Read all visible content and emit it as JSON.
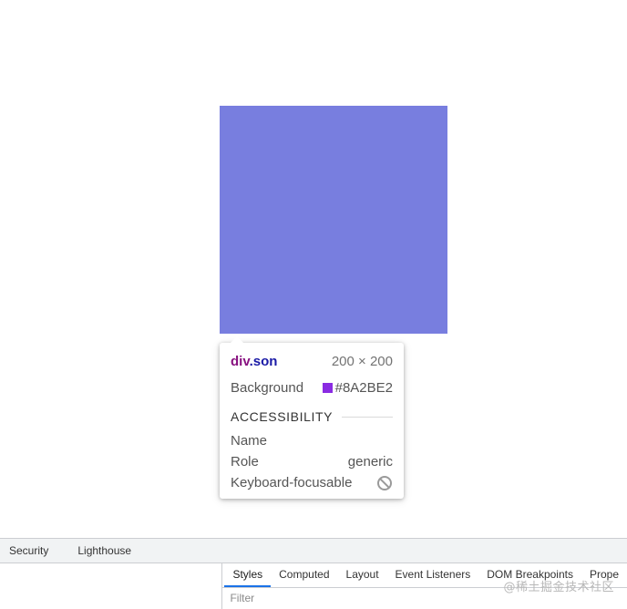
{
  "inspected_element": {
    "color": "#787EDF"
  },
  "tooltip": {
    "tag": "div",
    "class_name": ".son",
    "size": "200 × 200",
    "background_label": "Background",
    "background_value": "#8A2BE2",
    "background_color": "#8A2BE2",
    "accessibility_title": "ACCESSIBILITY",
    "name_label": "Name",
    "name_value": "",
    "role_label": "Role",
    "role_value": "generic",
    "keyboard_label": "Keyboard-focusable",
    "keyboard_icon": "not-allowed-icon"
  },
  "devtools": {
    "main_tabs": [
      {
        "label": "Security"
      },
      {
        "label": "Lighthouse"
      }
    ],
    "side_tabs": [
      {
        "label": "Styles",
        "active": true
      },
      {
        "label": "Computed"
      },
      {
        "label": "Layout"
      },
      {
        "label": "Event Listeners"
      },
      {
        "label": "DOM Breakpoints"
      },
      {
        "label": "Prope"
      }
    ],
    "filter_placeholder": "Filter"
  },
  "watermark": "@稀土掘金技术社区"
}
